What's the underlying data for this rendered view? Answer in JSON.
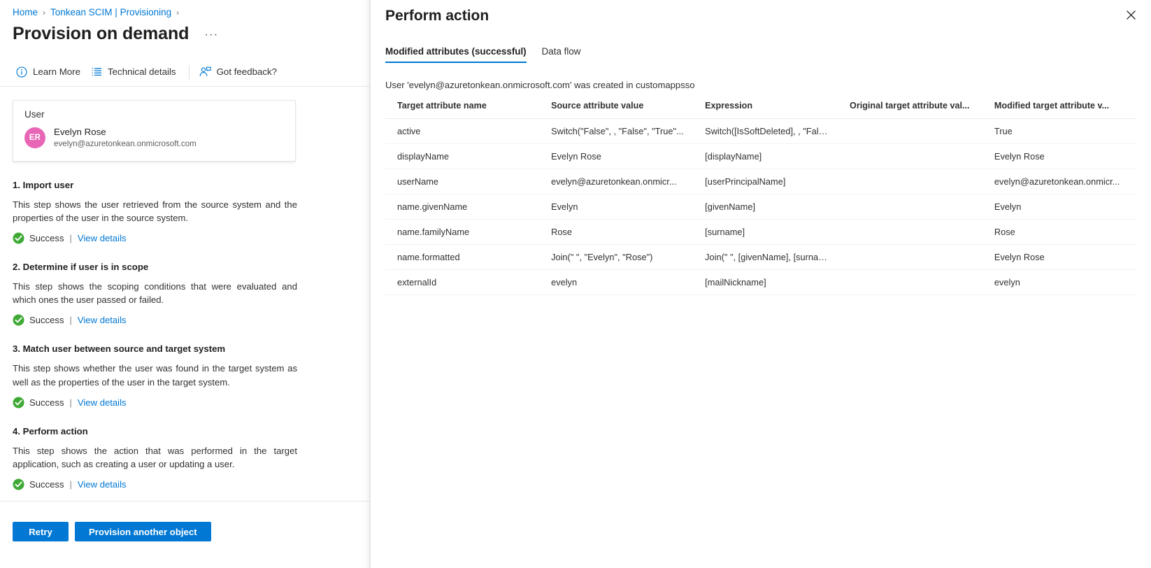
{
  "breadcrumb": {
    "items": [
      {
        "label": "Home"
      },
      {
        "label": "Tonkean SCIM | Provisioning"
      }
    ],
    "separator": "›"
  },
  "page": {
    "title": "Provision on demand",
    "overflow_label": "···"
  },
  "commandbar": {
    "items": [
      {
        "label": "Learn More",
        "icon": "info-circle-icon"
      },
      {
        "label": "Technical details",
        "icon": "list-details-icon"
      },
      {
        "label": "Got feedback?",
        "icon": "person-feedback-icon"
      }
    ]
  },
  "user_card": {
    "label": "User",
    "initials": "ER",
    "name": "Evelyn Rose",
    "email": "evelyn@azuretonkean.onmicrosoft.com",
    "avatar_color": "#e766b5"
  },
  "steps": [
    {
      "title": "1. Import user",
      "description": "This step shows the user retrieved from the source system and the properties of the user in the source system.",
      "status": "Success",
      "link": "View details",
      "separator": "|"
    },
    {
      "title": "2. Determine if user is in scope",
      "description": "This step shows the scoping conditions that were evaluated and which ones the user passed or failed.",
      "status": "Success",
      "link": "View details",
      "separator": "|"
    },
    {
      "title": "3. Match user between source and target system",
      "description": "This step shows whether the user was found in the target system as well as the properties of the user in the target system.",
      "status": "Success",
      "link": "View details",
      "separator": "|"
    },
    {
      "title": "4. Perform action",
      "description": "This step shows the action that was performed in the target application, such as creating a user or updating a user.",
      "status": "Success",
      "link": "View details",
      "separator": "|"
    }
  ],
  "footer": {
    "retry_label": "Retry",
    "provision_label": "Provision another object"
  },
  "blade": {
    "title": "Perform action",
    "close_label": "×",
    "tabs": [
      {
        "label": "Modified attributes (successful)",
        "active": true
      },
      {
        "label": "Data flow",
        "active": false
      }
    ],
    "subtitle": "User 'evelyn@azuretonkean.onmicrosoft.com' was created in customappsso",
    "table": {
      "headers": [
        "Target attribute name",
        "Source attribute value",
        "Expression",
        "Original target attribute val...",
        "Modified target attribute v..."
      ],
      "rows": [
        {
          "target_attribute_name": "active",
          "source_attribute_value": "Switch(\"False\", , \"False\", \"True\"...",
          "expression": "Switch([IsSoftDeleted], , \"False...",
          "original_target_attribute_value": "",
          "modified_target_attribute_value": "True"
        },
        {
          "target_attribute_name": "displayName",
          "source_attribute_value": "Evelyn Rose",
          "expression": "[displayName]",
          "original_target_attribute_value": "",
          "modified_target_attribute_value": "Evelyn Rose"
        },
        {
          "target_attribute_name": "userName",
          "source_attribute_value": "evelyn@azuretonkean.onmicr...",
          "expression": "[userPrincipalName]",
          "original_target_attribute_value": "",
          "modified_target_attribute_value": "evelyn@azuretonkean.onmicr..."
        },
        {
          "target_attribute_name": "name.givenName",
          "source_attribute_value": "Evelyn",
          "expression": "[givenName]",
          "original_target_attribute_value": "",
          "modified_target_attribute_value": "Evelyn"
        },
        {
          "target_attribute_name": "name.familyName",
          "source_attribute_value": "Rose",
          "expression": "[surname]",
          "original_target_attribute_value": "",
          "modified_target_attribute_value": "Rose"
        },
        {
          "target_attribute_name": "name.formatted",
          "source_attribute_value": "Join(\" \", \"Evelyn\", \"Rose\")",
          "expression": "Join(\" \", [givenName], [surnam...",
          "original_target_attribute_value": "",
          "modified_target_attribute_value": "Evelyn Rose"
        },
        {
          "target_attribute_name": "externalId",
          "source_attribute_value": "evelyn",
          "expression": "[mailNickname]",
          "original_target_attribute_value": "",
          "modified_target_attribute_value": "evelyn"
        }
      ]
    }
  },
  "colors": {
    "accent": "#0078d4",
    "success": "#3eaa35",
    "text": "#323130",
    "border": "#edebe9"
  }
}
